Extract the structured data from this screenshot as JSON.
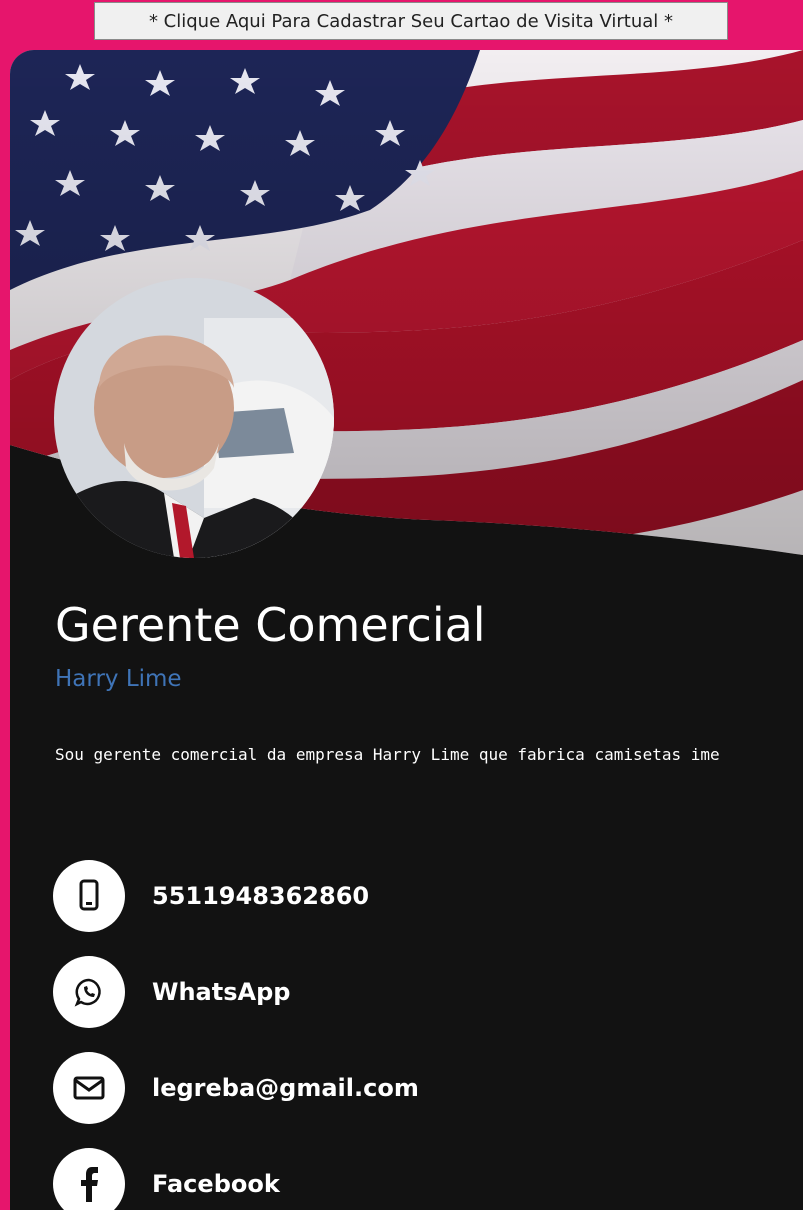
{
  "banner": {
    "text": "* Clique Aqui Para Cadastrar Seu Cartao de Visita Virtual *"
  },
  "profile": {
    "title": "Gerente Comercial",
    "name": "Harry Lime",
    "bio": "Sou gerente comercial da empresa Harry Lime que fabrica camisetas ime"
  },
  "contacts": [
    {
      "icon": "phone-icon",
      "label": "5511948362860"
    },
    {
      "icon": "whatsapp-icon",
      "label": "WhatsApp"
    },
    {
      "icon": "email-icon",
      "label": "legreba@gmail.com"
    },
    {
      "icon": "facebook-icon",
      "label": "Facebook"
    }
  ],
  "colors": {
    "page_background": "#e6156c",
    "card_background": "#121212",
    "name_accent": "#3f74b7",
    "flag_red": "#b3122a",
    "flag_blue": "#1d2556"
  }
}
